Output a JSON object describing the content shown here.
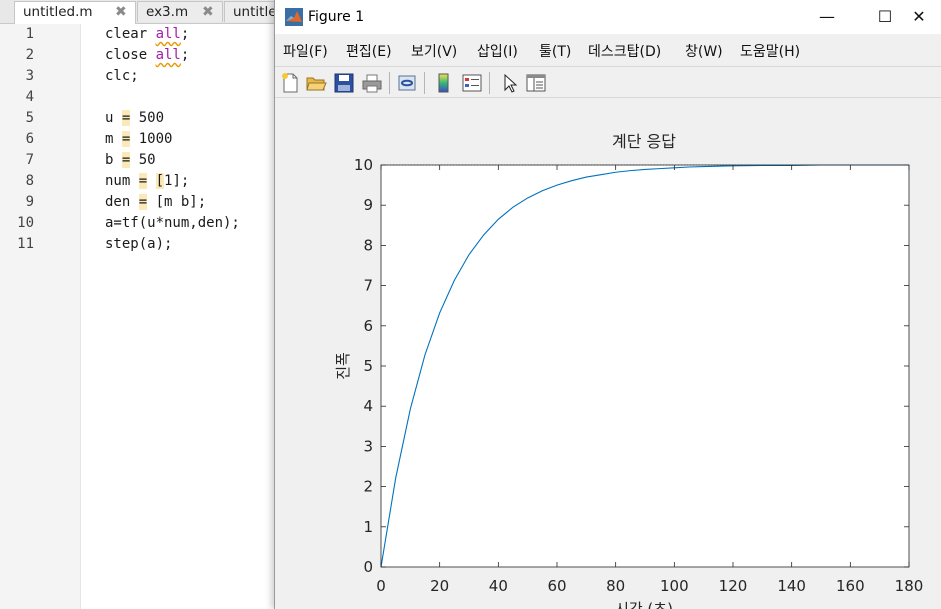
{
  "editor": {
    "tabs": [
      {
        "label": "untitled.m",
        "active": true
      },
      {
        "label": "ex3.m",
        "active": false
      },
      {
        "label": "untitled",
        "active": false
      }
    ],
    "lines": [
      {
        "num": "1",
        "text": "clear all;"
      },
      {
        "num": "2",
        "text": "close all;"
      },
      {
        "num": "3",
        "text": "clc;"
      },
      {
        "num": "4",
        "text": ""
      },
      {
        "num": "5",
        "text": "u = 500"
      },
      {
        "num": "6",
        "text": "m = 1000"
      },
      {
        "num": "7",
        "text": "b = 50"
      },
      {
        "num": "8",
        "text": "num = [1];"
      },
      {
        "num": "9",
        "text": "den = [m b];"
      },
      {
        "num": "10",
        "text": "a=tf(u*num,den);"
      },
      {
        "num": "11",
        "text": "step(a);"
      }
    ],
    "keyword_color": "#a51dac",
    "highlight_color": "#fbe9b7"
  },
  "figure": {
    "title": "Figure 1",
    "window_controls": {
      "minimize": "—",
      "maximize": "☐",
      "close": "✕"
    },
    "menu": [
      "파일(F)",
      "편집(E)",
      "보기(V)",
      "삽입(I)",
      "툴(T)",
      "데스크탑(D)",
      "창(W)",
      "도움말(H)"
    ],
    "toolbar": [
      "new-figure-icon",
      "open-folder-icon",
      "save-icon",
      "print-icon",
      "link-icon",
      "colorbar-icon",
      "legend-icon",
      "pointer-icon",
      "property-editor-icon"
    ]
  },
  "chart_data": {
    "type": "line",
    "title": "계단 응답",
    "xlabel": "시간 (초)",
    "ylabel": "진폭",
    "xlim": [
      0,
      180
    ],
    "ylim": [
      0,
      10
    ],
    "xticks": [
      0,
      20,
      40,
      60,
      80,
      100,
      120,
      140,
      160,
      180
    ],
    "yticks": [
      0,
      1,
      2,
      3,
      4,
      5,
      6,
      7,
      8,
      9,
      10
    ],
    "grid": false,
    "series": [
      {
        "color": "#0072bd",
        "x": [
          0,
          5,
          10,
          15,
          20,
          25,
          30,
          35,
          40,
          45,
          50,
          55,
          60,
          65,
          70,
          75,
          80,
          85,
          90,
          95,
          100,
          105,
          110,
          115,
          120,
          130,
          140,
          150,
          160,
          170,
          180
        ],
        "y": [
          0,
          2.21,
          3.93,
          5.28,
          6.32,
          7.13,
          7.77,
          8.26,
          8.65,
          8.95,
          9.18,
          9.36,
          9.5,
          9.61,
          9.7,
          9.76,
          9.82,
          9.86,
          9.89,
          9.91,
          9.93,
          9.95,
          9.96,
          9.97,
          9.98,
          9.99,
          9.99,
          10.0,
          10.0,
          10.0,
          10.0
        ]
      }
    ],
    "final_value": 10
  }
}
